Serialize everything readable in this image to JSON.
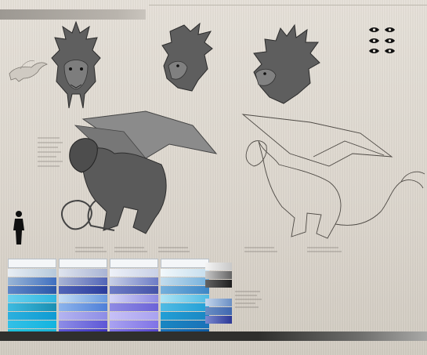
{
  "sheet": {
    "background_color": "#e2ddd5",
    "title_bar_color": "#a9a59f"
  },
  "head_views": [
    {
      "name": "front-head-icon"
    },
    {
      "name": "side-head-left-icon"
    },
    {
      "name": "side-head-right-icon"
    }
  ],
  "eyes": {
    "count": 6,
    "icon": "eye-icon",
    "color": "#111111"
  },
  "palettes": [
    {
      "name": "palette-1",
      "colors": [
        "#d8e4ef",
        "#b6c9db",
        "#7fa7d3",
        "#3f6fc0",
        "#2b57a8",
        "#2fb6e0",
        "#20a6c9",
        "#1a8fb2",
        "#0f9bd3",
        "#14b4df",
        "#1ab0d2"
      ]
    },
    {
      "name": "palette-2",
      "colors": [
        "#cfd6e6",
        "#a9b4d4",
        "#7f8fc6",
        "#5265b8",
        "#2a3c9c",
        "#9ec3ec",
        "#6a9be0",
        "#4f7fd8",
        "#8d8de6",
        "#5e57d6",
        "#3b32b8"
      ]
    },
    {
      "name": "palette-3",
      "colors": [
        "#e7ecf4",
        "#c8d0e6",
        "#a2aed9",
        "#6d7cc6",
        "#4453a8",
        "#b8b8ee",
        "#8f8be4",
        "#6c63d8",
        "#a9a2f0",
        "#7f73e6",
        "#5446c9"
      ]
    },
    {
      "name": "palette-4",
      "colors": [
        "#e8f2f8",
        "#c4dded",
        "#9cc6e2",
        "#74b0dc",
        "#3c86c6",
        "#7dd1ec",
        "#4fbbe4",
        "#229fd6",
        "#1a86c2",
        "#1b72b8",
        "#0e5aa0"
      ]
    },
    {
      "name": "palette-5",
      "colors": [
        "#eeeeee",
        "#c8c8c8",
        "#969696",
        "#646464",
        "#3a3a3a",
        "#9fb8d8",
        "#6a8fc4",
        "#3f67b0",
        "#7a8ad0",
        "#4d58b8",
        "#2c3896"
      ]
    }
  ]
}
